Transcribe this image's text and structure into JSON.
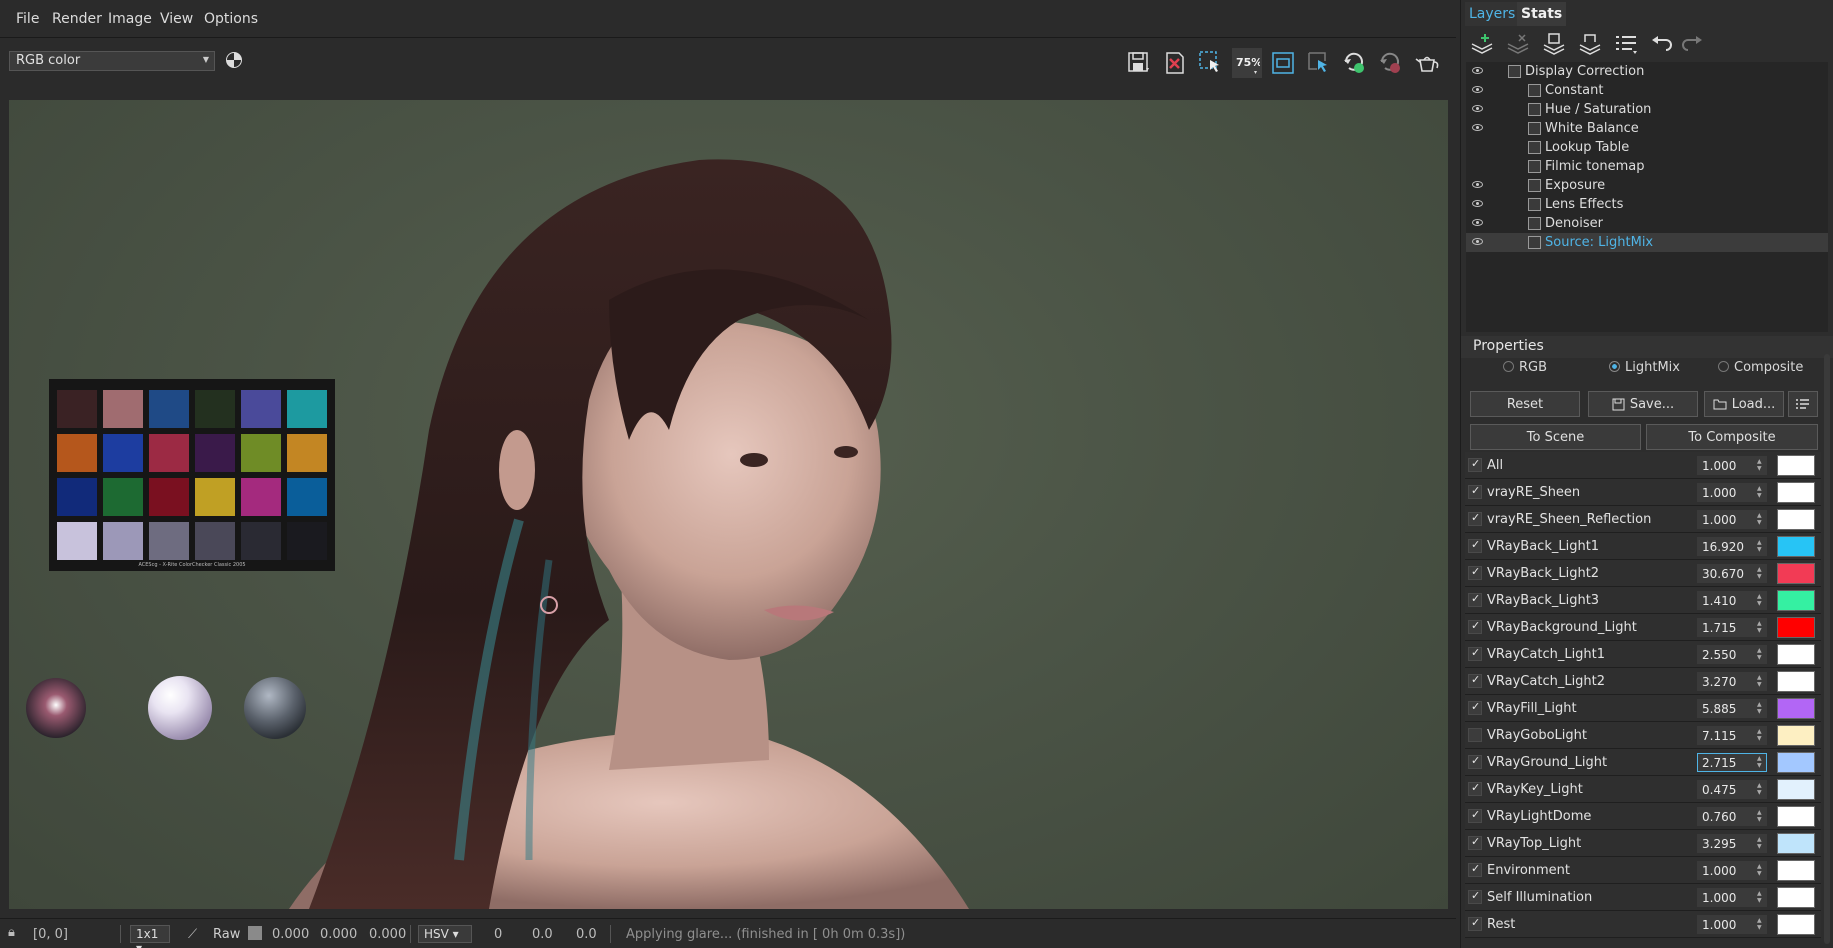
{
  "menu": [
    "File",
    "Render",
    "Image",
    "View",
    "Options"
  ],
  "toolbar": {
    "channel": "RGB color",
    "zoom_label": "75%",
    "icons": [
      "save-icon",
      "clear-icon",
      "region-select-icon",
      "zoom-icon",
      "fit-icon",
      "track-mouse-icon",
      "render-icon",
      "stop-render-icon",
      "teapot-render-icon"
    ]
  },
  "colorchecker_caption": "ACEScg - X-Rite ColorChecker Classic 2005",
  "status": {
    "coords": "[0, 0]",
    "ratio": "1x1",
    "raw_label": "Raw",
    "raw_values": [
      "0.000",
      "0.000",
      "0.000"
    ],
    "color_mode": "HSV",
    "hsv_values": [
      "0",
      "0.0",
      "0.0"
    ],
    "message": "Applying glare... (finished in [ 0h  0m  0.3s])"
  },
  "panel": {
    "tabs": [
      "Layers",
      "Stats"
    ],
    "layers": [
      {
        "name": "Display Correction",
        "eye": true,
        "indent": 0
      },
      {
        "name": "Constant",
        "eye": true,
        "indent": 1
      },
      {
        "name": "Hue / Saturation",
        "eye": true,
        "indent": 1
      },
      {
        "name": "White Balance",
        "eye": true,
        "indent": 1
      },
      {
        "name": "Lookup Table",
        "eye": false,
        "indent": 1
      },
      {
        "name": "Filmic tonemap",
        "eye": false,
        "indent": 1
      },
      {
        "name": "Exposure",
        "eye": true,
        "indent": 1
      },
      {
        "name": "Lens Effects",
        "eye": true,
        "indent": 1
      },
      {
        "name": "Denoiser",
        "eye": true,
        "indent": 1
      },
      {
        "name": "Source: LightMix",
        "eye": true,
        "indent": 1,
        "selected": true
      }
    ],
    "properties_title": "Properties",
    "modes": [
      {
        "label": "RGB",
        "selected": false
      },
      {
        "label": "LightMix",
        "selected": true
      },
      {
        "label": "Composite",
        "selected": false
      }
    ],
    "buttons": {
      "reset": "Reset",
      "save": "Save...",
      "load": "Load...",
      "to_scene": "To Scene",
      "to_composite": "To Composite"
    },
    "lightmix": [
      {
        "name": "All",
        "value": "1.000",
        "checked": true,
        "color": "#ffffff"
      },
      {
        "name": "vrayRE_Sheen",
        "value": "1.000",
        "checked": true,
        "color": "#ffffff"
      },
      {
        "name": "vrayRE_Sheen_Reflection",
        "value": "1.000",
        "checked": true,
        "color": "#ffffff"
      },
      {
        "name": "VRayBack_Light1",
        "value": "16.920",
        "checked": true,
        "color": "#27c4f5"
      },
      {
        "name": "VRayBack_Light2",
        "value": "30.670",
        "checked": true,
        "color": "#f23b55"
      },
      {
        "name": "VRayBack_Light3",
        "value": "1.410",
        "checked": true,
        "color": "#35f0a2"
      },
      {
        "name": "VRayBackground_Light",
        "value": "1.715",
        "checked": true,
        "color": "#ff0000"
      },
      {
        "name": "VRayCatch_Light1",
        "value": "2.550",
        "checked": true,
        "color": "#ffffff"
      },
      {
        "name": "VRayCatch_Light2",
        "value": "3.270",
        "checked": true,
        "color": "#ffffff"
      },
      {
        "name": "VRayFill_Light",
        "value": "5.885",
        "checked": true,
        "color": "#b266f5"
      },
      {
        "name": "VRayGoboLight",
        "value": "7.115",
        "checked": false,
        "color": "#fdefc2"
      },
      {
        "name": "VRayGround_Light",
        "value": "2.715",
        "checked": true,
        "color": "#a3c8ff",
        "focused": true
      },
      {
        "name": "VRayKey_Light",
        "value": "0.475",
        "checked": true,
        "color": "#e2f1fd"
      },
      {
        "name": "VRayLightDome",
        "value": "0.760",
        "checked": true,
        "color": "#ffffff"
      },
      {
        "name": "VRayTop_Light",
        "value": "3.295",
        "checked": true,
        "color": "#bfe4fb"
      },
      {
        "name": "Environment",
        "value": "1.000",
        "checked": true,
        "color": "#ffffff"
      },
      {
        "name": "Self Illumination",
        "value": "1.000",
        "checked": true,
        "color": "#ffffff"
      },
      {
        "name": "Rest",
        "value": "1.000",
        "checked": true,
        "color": "#ffffff"
      }
    ]
  }
}
